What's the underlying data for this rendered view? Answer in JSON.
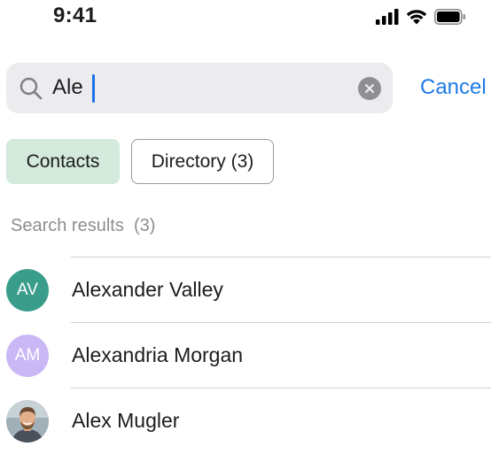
{
  "status_bar": {
    "time": "9:41",
    "icons": [
      "signal-icon",
      "wifi-icon",
      "battery-icon"
    ]
  },
  "search": {
    "value": "Ale",
    "icon": "search-icon",
    "clear_icon": "clear-icon",
    "cancel_label": "Cancel"
  },
  "filters": {
    "contacts_label": "Contacts",
    "directory_label": "Directory (3)",
    "selected": "Contacts"
  },
  "results": {
    "header": "Search results  (3)",
    "items": [
      {
        "name": "Alexander Valley",
        "initials": "AV",
        "avatar_color": "#3a9d8b"
      },
      {
        "name": "Alexandria Morgan",
        "initials": "AM",
        "avatar_color": "#c9b8f5"
      },
      {
        "name": "Alex Mugler",
        "initials": "",
        "avatar_type": "photo"
      }
    ]
  },
  "colors": {
    "accent": "#1f7ae8",
    "chip_selected_bg": "#d3eadd",
    "search_bg": "#ececef"
  }
}
